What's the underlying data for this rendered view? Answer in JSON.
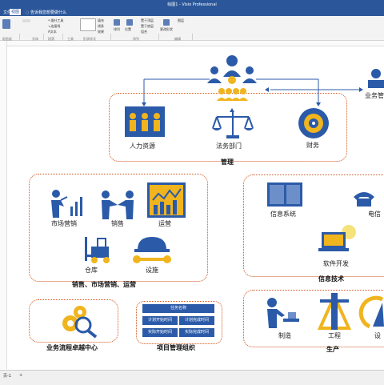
{
  "app": {
    "title": "绘图1 - Visio Professional",
    "menu_first": "文件",
    "menu_active": "视图",
    "tellme": "告诉我您想要做什么"
  },
  "ribbon": {
    "groups": [
      "粘贴板",
      "字体",
      "段落",
      "工具",
      "形状样式",
      "排列",
      "编辑"
    ],
    "buttons": {
      "pointer": "指针工具",
      "connector": "连接线",
      "text": "文本",
      "fill": "填充",
      "line": "线条",
      "effects": "效果",
      "align": "排列",
      "position": "位置",
      "bring_front": "置于顶层",
      "send_back": "置于底层",
      "group": "组合",
      "change_shape": "更改形状",
      "layers": "图层"
    }
  },
  "diagram": {
    "hr": "人力资源",
    "legal": "法务部门",
    "finance": "财务",
    "management_label": "管理",
    "business": "业务管",
    "marketing": "市场营销",
    "sales": "销售",
    "operations": "运营",
    "warehouse": "仓库",
    "facilities": "设施",
    "sales_group_label": "销售、市场营销、运营",
    "info_system": "信息系统",
    "telecom": "电信",
    "software": "软件开发",
    "it_label": "信息技术",
    "bpe_label": "业务流程卓越中心",
    "pm_label": "项目管理组织",
    "pm_table": {
      "header": "任务名称",
      "cells": [
        "计划开始时间",
        "计划完成时间",
        "实际开始时间",
        "实际完成时间"
      ]
    },
    "manufacturing": "制造",
    "engineering": "工程",
    "design": "设",
    "production_label": "生产"
  },
  "status": {
    "page": "页-1",
    "add": "+"
  },
  "colors": {
    "blue": "#2b5aa8",
    "gold": "#f0b41e",
    "orange": "#d2551b",
    "ribbon": "#2b579a"
  }
}
